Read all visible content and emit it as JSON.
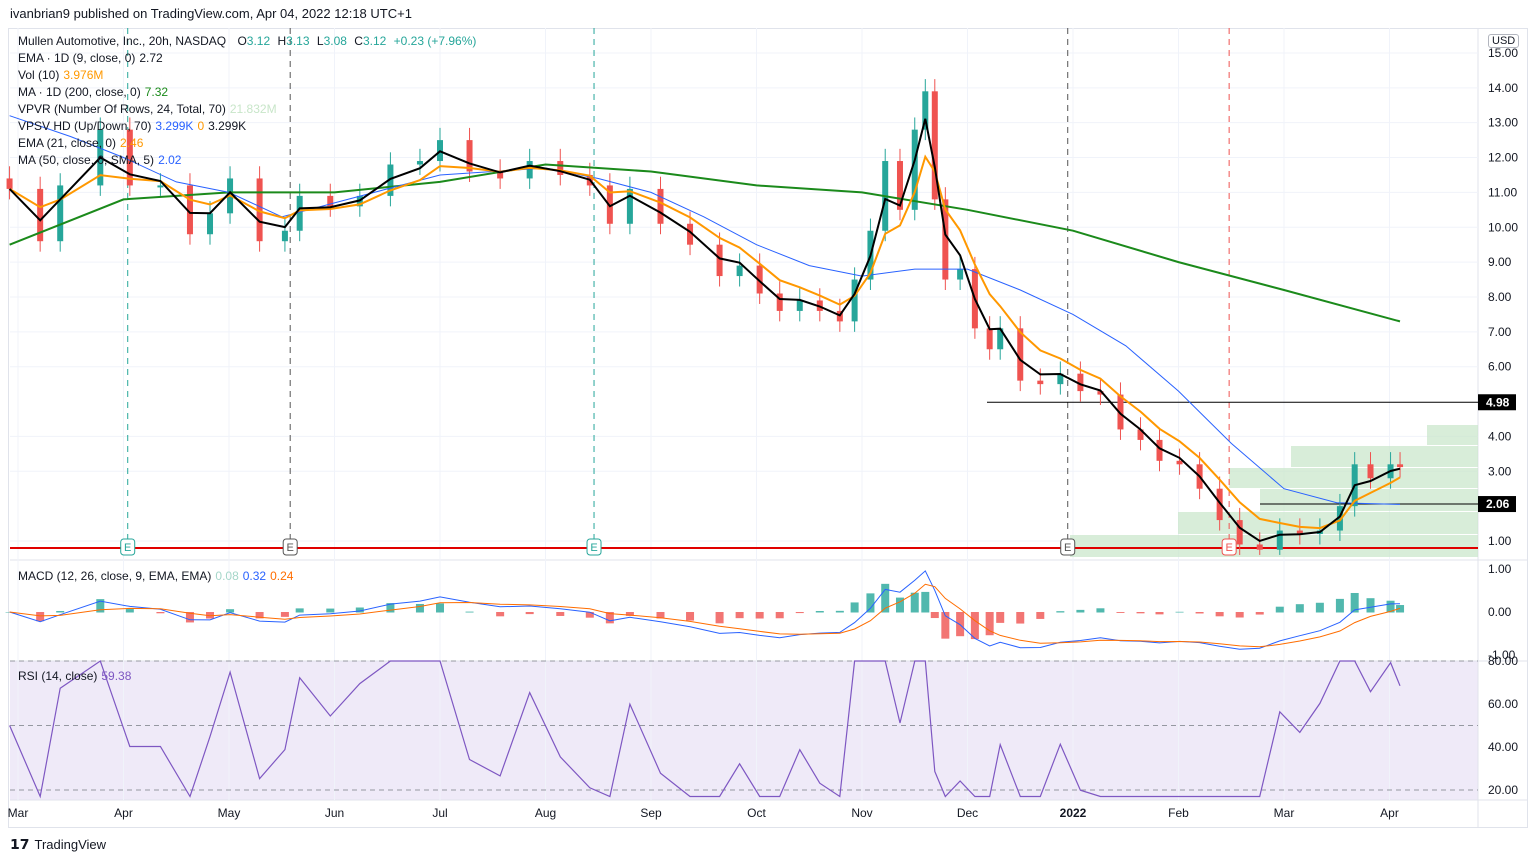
{
  "header": {
    "published": "ivanbrian9 published on TradingView.com, Apr 04, 2022 12:18 UTC+1"
  },
  "footer": {
    "brand": "TradingView"
  },
  "currency": "USD",
  "legend": {
    "symbol": "Mullen Automotive, Inc., 20h, NASDAQ",
    "o_label": "O",
    "o": "3.12",
    "h_label": "H",
    "h": "3.13",
    "l_label": "L",
    "l": "3.08",
    "c_label": "C",
    "c": "3.12",
    "change": "+0.23 (+7.96%)",
    "ema9": {
      "label": "EMA · 1D (9, close, 0)",
      "value": "2.72"
    },
    "vol": {
      "label": "Vol (10)",
      "value": "3.976M"
    },
    "ma200": {
      "label": "MA · 1D (200, close, 0)",
      "value": "7.32"
    },
    "vpvr": {
      "label": "VPVR (Number Of Rows, 24, Total, 70)",
      "value": "21.832M"
    },
    "vpsv": {
      "label": "VPSV HD (Up/Down, 70)",
      "v1": "3.299K",
      "v2": "0",
      "v3": "3.299K"
    },
    "ema21": {
      "label": "EMA (21, close, 0)",
      "value": "2.46"
    },
    "ma50": {
      "label": "MA (50, close, 0, SMA, 5)",
      "value": "2.02"
    },
    "macd": {
      "label": "MACD (12, 26, close, 9, EMA, EMA)",
      "hist": "0.08",
      "macd": "0.32",
      "signal": "0.24"
    },
    "rsi": {
      "label": "RSI (14, close)",
      "value": "59.38"
    }
  },
  "colors": {
    "up": "#26a69a",
    "down": "#ef5350",
    "ema9": "#000000",
    "ema21": "#ff9800",
    "ma50": "#2962ff",
    "ma200": "#1b8a1b",
    "rsi": "#7e57c2",
    "rsi_bg": "#efeaf8",
    "vp": "#c8e6c9"
  },
  "chart_data": {
    "type": "candlestick",
    "x_unit": "months since Mar 1 2021",
    "price_axis": {
      "ticks": [
        "15.00",
        "14.00",
        "13.00",
        "12.00",
        "11.00",
        "10.00",
        "9.00",
        "8.00",
        "7.00",
        "6.00",
        "4.00",
        "3.00",
        "1.00"
      ],
      "range": [
        1,
        15
      ]
    },
    "price_labels": [
      {
        "value": 4.98,
        "text": "4.98"
      },
      {
        "value": 2.06,
        "text": "2.06"
      }
    ],
    "support_line": 0.8,
    "x_ticks": [
      {
        "t": 0,
        "label": "Mar"
      },
      {
        "t": 1,
        "label": "Apr"
      },
      {
        "t": 2,
        "label": "May"
      },
      {
        "t": 3,
        "label": "Jun"
      },
      {
        "t": 4,
        "label": "Jul"
      },
      {
        "t": 5,
        "label": "Aug"
      },
      {
        "t": 6,
        "label": "Sep"
      },
      {
        "t": 7,
        "label": "Oct"
      },
      {
        "t": 8,
        "label": "Nov"
      },
      {
        "t": 9,
        "label": "Dec"
      },
      {
        "t": 10,
        "label": "2022"
      },
      {
        "t": 11,
        "label": "Feb"
      },
      {
        "t": 12,
        "label": "Mar"
      },
      {
        "t": 13,
        "label": "Apr"
      }
    ],
    "earnings": [
      {
        "t": 1.04,
        "label": "E",
        "color": "#26a69a"
      },
      {
        "t": 2.58,
        "label": "E",
        "color": "#555555"
      },
      {
        "t": 5.46,
        "label": "E",
        "color": "#26a69a"
      },
      {
        "t": 9.95,
        "label": "E",
        "color": "#555555"
      },
      {
        "t": 11.48,
        "label": "E",
        "color": "#ef5350"
      }
    ],
    "closes": [
      [
        -0.08,
        11.1
      ],
      [
        0.21,
        9.6
      ],
      [
        0.4,
        11.2
      ],
      [
        0.78,
        12.8
      ],
      [
        1.06,
        11.2
      ],
      [
        1.35,
        11.2
      ],
      [
        1.63,
        9.8
      ],
      [
        1.82,
        10.4
      ],
      [
        2.01,
        11.4
      ],
      [
        2.29,
        9.6
      ],
      [
        2.53,
        9.9
      ],
      [
        2.67,
        10.9
      ],
      [
        2.96,
        10.6
      ],
      [
        3.24,
        10.9
      ],
      [
        3.53,
        11.8
      ],
      [
        3.81,
        11.9
      ],
      [
        4.0,
        12.5
      ],
      [
        4.28,
        11.6
      ],
      [
        4.57,
        11.4
      ],
      [
        4.85,
        11.9
      ],
      [
        5.14,
        11.5
      ],
      [
        5.42,
        11.2
      ],
      [
        5.61,
        10.1
      ],
      [
        5.8,
        11.1
      ],
      [
        6.09,
        10.1
      ],
      [
        6.37,
        9.5
      ],
      [
        6.65,
        8.6
      ],
      [
        6.84,
        8.9
      ],
      [
        7.03,
        8.1
      ],
      [
        7.22,
        7.6
      ],
      [
        7.41,
        7.9
      ],
      [
        7.6,
        7.6
      ],
      [
        7.79,
        7.3
      ],
      [
        7.93,
        8.5
      ],
      [
        8.08,
        9.9
      ],
      [
        8.22,
        11.9
      ],
      [
        8.36,
        10.5
      ],
      [
        8.5,
        12.8
      ],
      [
        8.6,
        13.9
      ],
      [
        8.69,
        10.8
      ],
      [
        8.79,
        8.5
      ],
      [
        8.93,
        8.8
      ],
      [
        9.07,
        7.1
      ],
      [
        9.21,
        6.5
      ],
      [
        9.31,
        7.1
      ],
      [
        9.5,
        5.6
      ],
      [
        9.69,
        5.5
      ],
      [
        9.88,
        5.8
      ],
      [
        10.07,
        5.3
      ],
      [
        10.26,
        5.2
      ],
      [
        10.45,
        4.2
      ],
      [
        10.64,
        3.9
      ],
      [
        10.82,
        3.3
      ],
      [
        11.01,
        3.2
      ],
      [
        11.2,
        2.5
      ],
      [
        11.39,
        1.6
      ],
      [
        11.58,
        0.9
      ],
      [
        11.77,
        0.75
      ],
      [
        11.96,
        1.3
      ],
      [
        12.15,
        1.2
      ],
      [
        12.34,
        1.3
      ],
      [
        12.53,
        2.0
      ],
      [
        12.67,
        3.2
      ],
      [
        12.82,
        2.8
      ],
      [
        13.01,
        3.2
      ],
      [
        13.1,
        3.12
      ]
    ],
    "ma200_line": [
      [
        -0.08,
        9.5
      ],
      [
        1,
        10.8
      ],
      [
        2,
        11.0
      ],
      [
        3,
        11.0
      ],
      [
        4,
        11.3
      ],
      [
        5,
        11.8
      ],
      [
        6,
        11.6
      ],
      [
        7,
        11.2
      ],
      [
        8,
        11.0
      ],
      [
        9,
        10.5
      ],
      [
        10,
        9.9
      ],
      [
        11,
        9.0
      ],
      [
        12,
        8.2
      ],
      [
        13.1,
        7.3
      ]
    ],
    "ma50_line": [
      [
        -0.08,
        13.2
      ],
      [
        0.5,
        12.6
      ],
      [
        1,
        12
      ],
      [
        1.5,
        11.3
      ],
      [
        2,
        11.0
      ],
      [
        2.5,
        10.3
      ],
      [
        3,
        10.7
      ],
      [
        3.5,
        11.1
      ],
      [
        4,
        11.5
      ],
      [
        4.5,
        11.6
      ],
      [
        5,
        11.7
      ],
      [
        5.5,
        11.4
      ],
      [
        6,
        11.0
      ],
      [
        6.5,
        10.3
      ],
      [
        7,
        9.5
      ],
      [
        7.5,
        8.9
      ],
      [
        8,
        8.6
      ],
      [
        8.5,
        8.8
      ],
      [
        9,
        8.8
      ],
      [
        9.5,
        8.2
      ],
      [
        10,
        7.5
      ],
      [
        10.5,
        6.6
      ],
      [
        11,
        5.3
      ],
      [
        11.5,
        3.8
      ],
      [
        12,
        2.5
      ],
      [
        12.5,
        2.1
      ],
      [
        13.1,
        2.05
      ]
    ],
    "macd_axis": {
      "ticks": [
        "1.00",
        "0.00",
        "-1.00"
      ],
      "range": [
        -1,
        1
      ]
    },
    "rsi_axis": {
      "ticks": [
        "80.00",
        "60.00",
        "40.00",
        "20.00"
      ],
      "range": [
        15,
        80
      ]
    }
  }
}
